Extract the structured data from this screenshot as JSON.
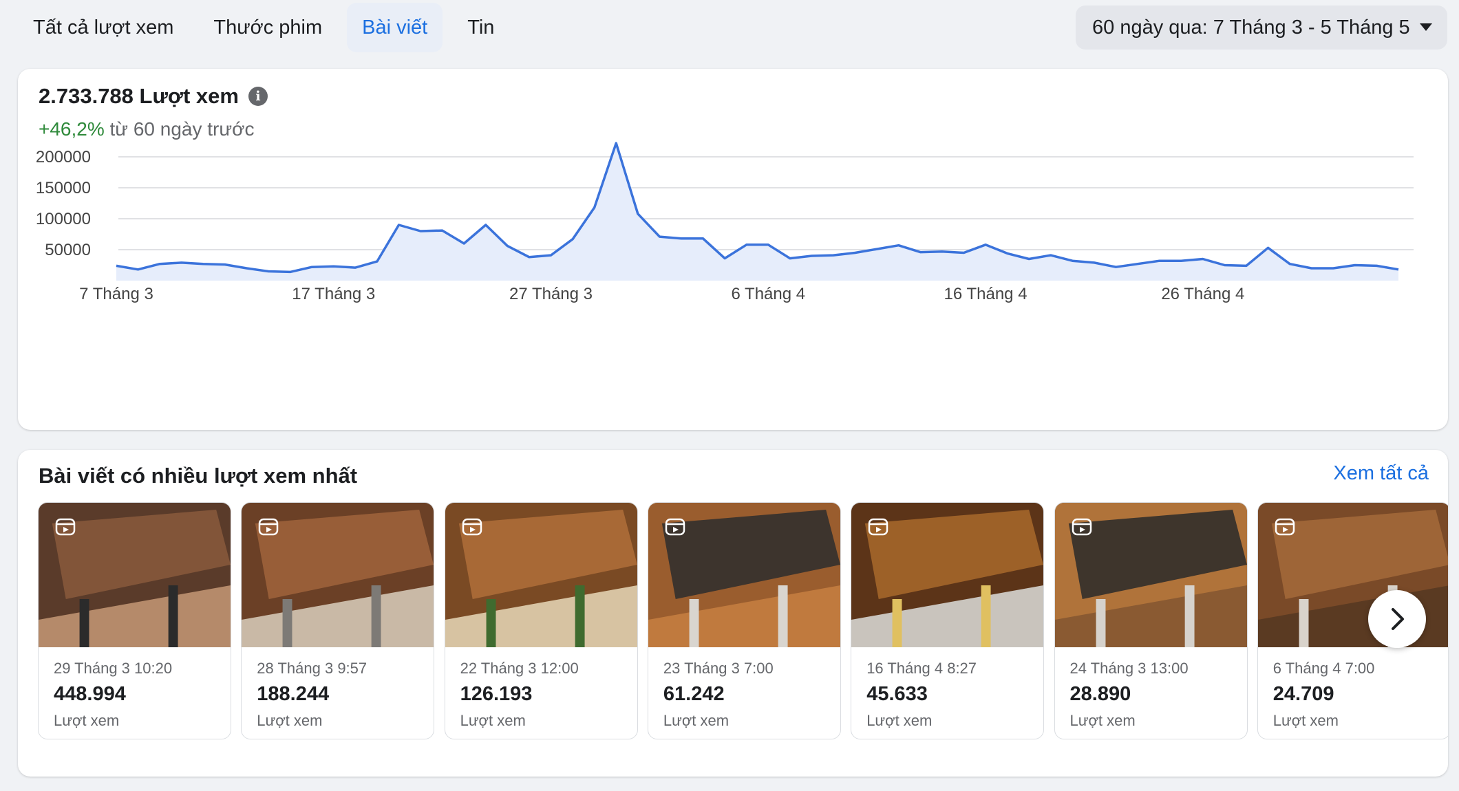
{
  "tabs": [
    {
      "label": "Tất cả lượt xem"
    },
    {
      "label": "Thước phim"
    },
    {
      "label": "Bài viết"
    },
    {
      "label": "Tin"
    }
  ],
  "date_range": {
    "label": "60 ngày qua: 7 Tháng 3 - 5 Tháng 5"
  },
  "summary": {
    "total": "2.733.788 Lượt xem",
    "change_pct": "+46,2%",
    "change_text": " từ 60 ngày trước"
  },
  "chart_data": {
    "type": "area",
    "x_tick_labels": [
      "7 Tháng 3",
      "17 Tháng 3",
      "27 Tháng 3",
      "6 Tháng 4",
      "16 Tháng 4",
      "26 Tháng 4"
    ],
    "y_ticks": [
      50000,
      100000,
      150000,
      200000
    ],
    "ylim": [
      0,
      210000
    ],
    "grid": true,
    "color": "#3b73db",
    "fill": "#e6edfb",
    "x": [
      "7 Tháng 3",
      "8 Tháng 3",
      "9 Tháng 3",
      "10 Tháng 3",
      "11 Tháng 3",
      "12 Tháng 3",
      "13 Tháng 3",
      "14 Tháng 3",
      "15 Tháng 3",
      "16 Tháng 3",
      "17 Tháng 3",
      "18 Tháng 3",
      "19 Tháng 3",
      "20 Tháng 3",
      "21 Tháng 3",
      "22 Tháng 3",
      "23 Tháng 3",
      "24 Tháng 3",
      "25 Tháng 3",
      "26 Tháng 3",
      "27 Tháng 3",
      "28 Tháng 3",
      "29 Tháng 3",
      "30 Tháng 3",
      "31 Tháng 3",
      "1 Tháng 4",
      "2 Tháng 4",
      "3 Tháng 4",
      "4 Tháng 4",
      "5 Tháng 4",
      "6 Tháng 4",
      "7 Tháng 4",
      "8 Tháng 4",
      "9 Tháng 4",
      "10 Tháng 4",
      "11 Tháng 4",
      "12 Tháng 4",
      "13 Tháng 4",
      "14 Tháng 4",
      "15 Tháng 4",
      "16 Tháng 4",
      "17 Tháng 4",
      "18 Tháng 4",
      "19 Tháng 4",
      "20 Tháng 4",
      "21 Tháng 4",
      "22 Tháng 4",
      "23 Tháng 4",
      "24 Tháng 4",
      "25 Tháng 4",
      "26 Tháng 4",
      "27 Tháng 4",
      "28 Tháng 4",
      "29 Tháng 4",
      "30 Tháng 4",
      "1 Tháng 5",
      "2 Tháng 5",
      "3 Tháng 5",
      "4 Tháng 5",
      "5 Tháng 5"
    ],
    "values": [
      24000,
      18000,
      27000,
      29000,
      27000,
      26000,
      20000,
      15000,
      14000,
      22000,
      23000,
      21000,
      31000,
      90000,
      80000,
      81000,
      60000,
      90000,
      56000,
      38000,
      41000,
      67000,
      118000,
      222000,
      108000,
      71000,
      68000,
      68000,
      36000,
      58000,
      58000,
      36000,
      40000,
      41000,
      45000,
      51000,
      57000,
      46000,
      47000,
      45000,
      58000,
      44000,
      35000,
      41000,
      32000,
      29000,
      22000,
      27000,
      32000,
      32000,
      35000,
      25000,
      24000,
      53000,
      27000,
      20000,
      20000,
      25000,
      24000,
      18000
    ]
  },
  "top_posts": {
    "title": "Bài viết có nhiều lượt xem nhất",
    "see_all": "Xem tất cả",
    "items": [
      {
        "date": "29 Tháng 3 10:20",
        "views": "448.994",
        "label": "Lượt xem"
      },
      {
        "date": "28 Tháng 3 9:57",
        "views": "188.244",
        "label": "Lượt xem"
      },
      {
        "date": "22 Tháng 3 12:00",
        "views": "126.193",
        "label": "Lượt xem"
      },
      {
        "date": "23 Tháng 3 7:00",
        "views": "61.242",
        "label": "Lượt xem"
      },
      {
        "date": "16 Tháng 4 8:27",
        "views": "45.633",
        "label": "Lượt xem"
      },
      {
        "date": "24 Tháng 3 13:00",
        "views": "28.890",
        "label": "Lượt xem"
      },
      {
        "date": "6 Tháng 4 7:00",
        "views": "24.709",
        "label": "Lượt xem"
      }
    ]
  },
  "icons": {
    "info": "info-icon",
    "reel": "reel-icon",
    "next": "chevron-right-icon",
    "caret": "caret-down-icon"
  },
  "colors": {
    "accent": "#1b6fe0",
    "positive": "#2f8a3b",
    "line": "#3b73db"
  }
}
